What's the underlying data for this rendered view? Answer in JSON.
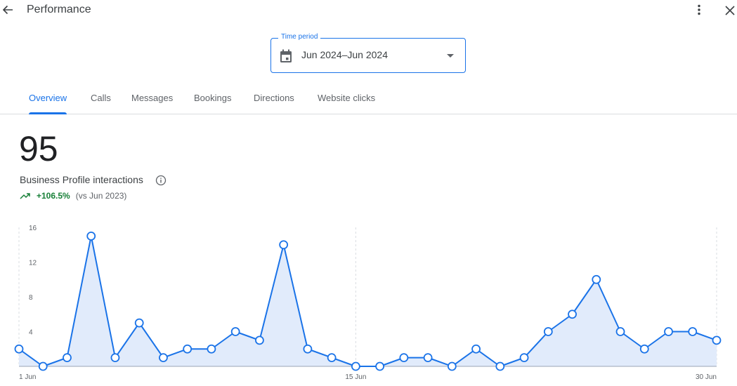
{
  "header": {
    "title": "Performance",
    "back_icon": "arrow-left-icon",
    "more_icon": "more-vert-icon",
    "close_icon": "close-icon"
  },
  "time_period": {
    "label": "Time period",
    "value": "Jun 2024–Jun 2024",
    "icon": "calendar-icon"
  },
  "tabs": [
    {
      "label": "Overview",
      "active": true
    },
    {
      "label": "Calls",
      "active": false
    },
    {
      "label": "Messages",
      "active": false
    },
    {
      "label": "Bookings",
      "active": false
    },
    {
      "label": "Directions",
      "active": false
    },
    {
      "label": "Website clicks",
      "active": false
    }
  ],
  "summary": {
    "total": "95",
    "label": "Business Profile interactions",
    "change": "+106.5%",
    "comparison": "(vs Jun 2023)",
    "trend_icon": "trending-up-icon",
    "trend_color": "#188038"
  },
  "colors": {
    "accent": "#1a73e8",
    "area_fill": "#e1ebfb",
    "baseline": "#9aa5b6",
    "gridline": "#dadce0"
  },
  "chart_data": {
    "type": "area",
    "title": "",
    "xlabel": "",
    "ylabel": "",
    "x": [
      "1 Jun",
      "2 Jun",
      "3 Jun",
      "4 Jun",
      "5 Jun",
      "6 Jun",
      "7 Jun",
      "8 Jun",
      "9 Jun",
      "10 Jun",
      "11 Jun",
      "12 Jun",
      "13 Jun",
      "14 Jun",
      "15 Jun",
      "16 Jun",
      "17 Jun",
      "18 Jun",
      "19 Jun",
      "20 Jun",
      "21 Jun",
      "22 Jun",
      "23 Jun",
      "24 Jun",
      "25 Jun",
      "26 Jun",
      "27 Jun",
      "28 Jun",
      "29 Jun",
      "30 Jun"
    ],
    "series": [
      {
        "name": "Business Profile interactions",
        "values": [
          2,
          0,
          1,
          15,
          1,
          5,
          1,
          2,
          2,
          4,
          3,
          14,
          2,
          1,
          0,
          0,
          1,
          1,
          0,
          2,
          0,
          1,
          4,
          6,
          10,
          4,
          2,
          4,
          4,
          3
        ]
      }
    ],
    "ylim": [
      0,
      16
    ],
    "yticks": [
      4,
      8,
      12,
      16
    ],
    "xtick_labels": [
      {
        "index": 0,
        "label": "1 Jun"
      },
      {
        "index": 14,
        "label": "15 Jun"
      },
      {
        "index": 29,
        "label": "30 Jun"
      }
    ],
    "grid": "vertical dashed at x ticks",
    "legend": "none"
  }
}
